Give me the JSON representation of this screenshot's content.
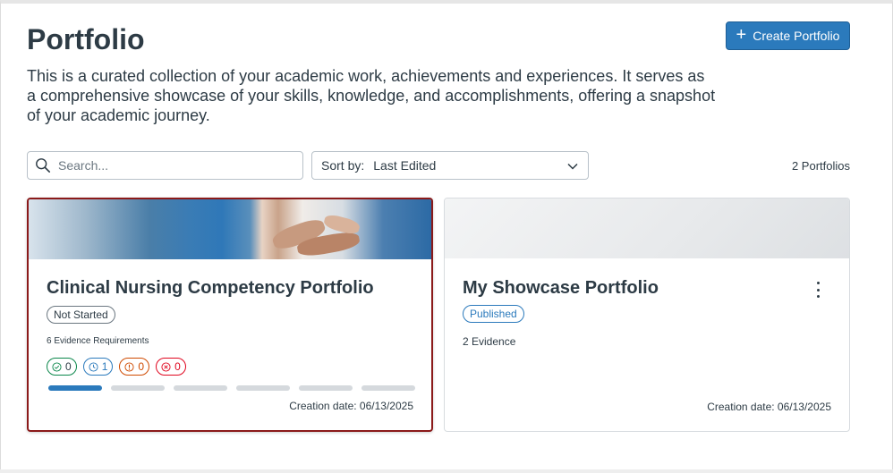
{
  "header": {
    "title": "Portfolio",
    "description": "This is a curated collection of your academic work, achievements and experiences. It serves as a comprehensive showcase of your skills, knowledge, and accomplishments, offering a snapshot of your academic journey.",
    "create_button": "Create Portfolio",
    "create_icon": "plus-icon"
  },
  "toolbar": {
    "search_placeholder": "Search...",
    "search_icon": "search-icon",
    "sort_label": "Sort by:",
    "sort_value": "Last Edited",
    "sort_icon": "chevron-down-icon",
    "count": "2 Portfolios"
  },
  "colors": {
    "accent": "#2b7abc",
    "selected_border": "#8b1a1a",
    "success": "#0b874b",
    "warning": "#cf4a00",
    "danger": "#e0061f",
    "text": "#2d3b45"
  },
  "cards": [
    {
      "title": "Clinical Nursing Competency Portfolio",
      "status": "Not Started",
      "meta": "6 Evidence Requirements",
      "pills": [
        {
          "icon": "check-circle-icon",
          "value": "0"
        },
        {
          "icon": "clock-icon",
          "value": "1"
        },
        {
          "icon": "warning-icon",
          "value": "0"
        },
        {
          "icon": "x-circle-icon",
          "value": "0"
        }
      ],
      "progress_segments": 6,
      "progress_complete": 1,
      "date": "Creation date: 06/13/2025",
      "selected": true
    },
    {
      "title": "My Showcase Portfolio",
      "status": "Published",
      "meta": "2 Evidence",
      "date": "Creation date: 06/13/2025",
      "menu_icon": "kebab-menu-icon"
    }
  ]
}
